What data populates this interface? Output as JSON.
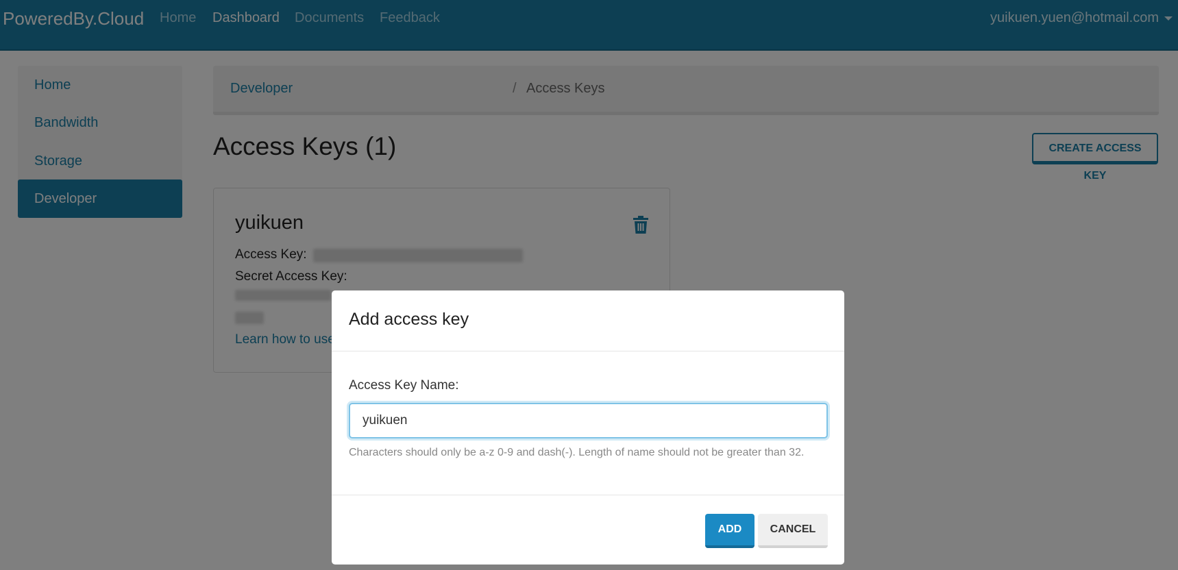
{
  "navbar": {
    "brand": "PoweredBy.Cloud",
    "links": [
      "Home",
      "Dashboard",
      "Documents",
      "Feedback"
    ],
    "active_link": "Dashboard",
    "user_email": "yuikuen.yuen@hotmail.com"
  },
  "sidebar": {
    "items": [
      {
        "label": "Home"
      },
      {
        "label": "Bandwidth"
      },
      {
        "label": "Storage"
      },
      {
        "label": "Developer"
      }
    ],
    "active": "Developer"
  },
  "breadcrumb": {
    "parent": "Developer",
    "separator": "/",
    "current": "Access Keys"
  },
  "main": {
    "title": "Access Keys (1)",
    "create_button": "CREATE ACCESS KEY"
  },
  "card": {
    "name": "yuikuen",
    "access_key_label": "Access Key:",
    "secret_key_label": "Secret Access Key:",
    "learn_link": "Learn how to use"
  },
  "modal": {
    "title": "Add access key",
    "field_label": "Access Key Name:",
    "field_value": "yuikuen",
    "help_text": "Characters should only be a-z 0-9 and dash(-). Length of name should not be greater than 32.",
    "add_button": "ADD",
    "cancel_button": "CANCEL"
  },
  "colors": {
    "brand": "#1a7fa6",
    "primary_button": "#1b8ac4"
  }
}
